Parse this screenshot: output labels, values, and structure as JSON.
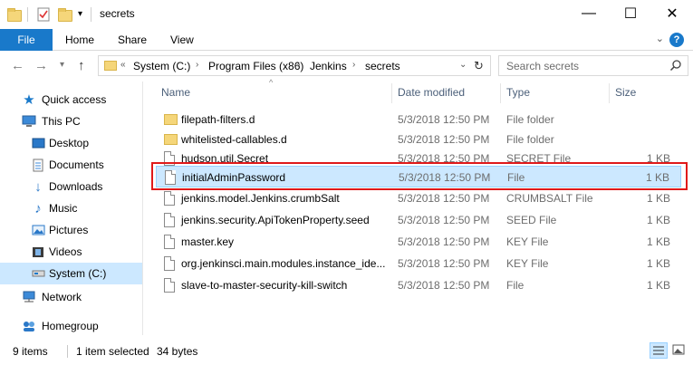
{
  "window": {
    "title": "secrets",
    "minimize_glyph": "—",
    "maximize_glyph": "☐",
    "close_glyph": "✕"
  },
  "ribbon": {
    "file_tab": "File",
    "tabs": [
      "Home",
      "Share",
      "View"
    ],
    "expand_glyph": "⌄",
    "help_glyph": "?"
  },
  "address": {
    "overflow": "«",
    "crumbs": [
      "System (C:)",
      "Program Files (x86)",
      "Jenkins",
      "secrets"
    ],
    "search_placeholder": "Search secrets"
  },
  "sidebar": {
    "items": [
      {
        "label": "Quick access",
        "icon": "star-icon"
      },
      {
        "label": "This PC",
        "icon": "computer-icon"
      },
      {
        "label": "Desktop",
        "icon": "desktop-icon"
      },
      {
        "label": "Documents",
        "icon": "documents-icon"
      },
      {
        "label": "Downloads",
        "icon": "download-icon"
      },
      {
        "label": "Music",
        "icon": "music-icon"
      },
      {
        "label": "Pictures",
        "icon": "pictures-icon"
      },
      {
        "label": "Videos",
        "icon": "videos-icon"
      },
      {
        "label": "System (C:)",
        "icon": "drive-icon"
      },
      {
        "label": "Network",
        "icon": "network-icon"
      },
      {
        "label": "Homegroup",
        "icon": "homegroup-icon"
      }
    ]
  },
  "columns": {
    "name": "Name",
    "date": "Date modified",
    "type": "Type",
    "size": "Size"
  },
  "files": [
    {
      "name": "filepath-filters.d",
      "date": "5/3/2018 12:50 PM",
      "type": "File folder",
      "size": "",
      "kind": "folder"
    },
    {
      "name": "whitelisted-callables.d",
      "date": "5/3/2018 12:50 PM",
      "type": "File folder",
      "size": "",
      "kind": "folder"
    },
    {
      "name": "hudson.util.Secret",
      "date": "5/3/2018 12:50 PM",
      "type": "SECRET File",
      "size": "1 KB",
      "kind": "file"
    },
    {
      "name": "initialAdminPassword",
      "date": "5/3/2018 12:50 PM",
      "type": "File",
      "size": "1 KB",
      "kind": "file"
    },
    {
      "name": "jenkins.model.Jenkins.crumbSalt",
      "date": "5/3/2018 12:50 PM",
      "type": "CRUMBSALT File",
      "size": "1 KB",
      "kind": "file"
    },
    {
      "name": "jenkins.security.ApiTokenProperty.seed",
      "date": "5/3/2018 12:50 PM",
      "type": "SEED File",
      "size": "1 KB",
      "kind": "file"
    },
    {
      "name": "master.key",
      "date": "5/3/2018 12:50 PM",
      "type": "KEY File",
      "size": "1 KB",
      "kind": "file"
    },
    {
      "name": "org.jenkinsci.main.modules.instance_ide...",
      "date": "5/3/2018 12:50 PM",
      "type": "KEY File",
      "size": "1 KB",
      "kind": "file"
    },
    {
      "name": "slave-to-master-security-kill-switch",
      "date": "5/3/2018 12:50 PM",
      "type": "File",
      "size": "1 KB",
      "kind": "file"
    }
  ],
  "status": {
    "items": "9 items",
    "selected": "1 item selected",
    "size": "34 bytes"
  },
  "colors": {
    "accent": "#1979ca",
    "selection": "#cce8ff",
    "highlight_box": "#e0191a"
  }
}
